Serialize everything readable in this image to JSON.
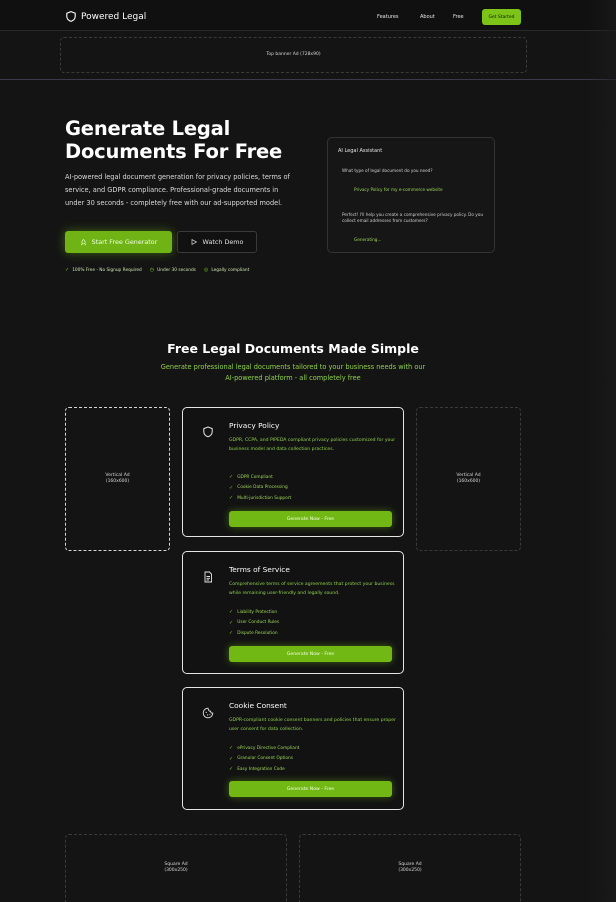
{
  "header": {
    "brand": "Powered Legal",
    "nav": [
      {
        "label": "Features"
      },
      {
        "label": "About"
      },
      {
        "label": "Free"
      }
    ],
    "cta": "Get Started"
  },
  "ads": {
    "top": "Top banner Ad (728x90)",
    "left": [
      "Vertical Ad",
      "(160x600)"
    ],
    "right": [
      "Vertical Ad",
      "(160x600)"
    ],
    "bottom_left": [
      "Square Ad",
      "(300x250)"
    ],
    "bottom_right": [
      "Square Ad",
      "(300x250)"
    ]
  },
  "hero": {
    "title_line1": "Generate Legal",
    "title_line2": "Documents For Free",
    "description": "AI-powered legal document generation for privacy policies, terms of service, and GDPR compliance. Professional-grade documents in under 30 seconds - completely free with our ad-supported model.",
    "primary_button": "Start Free Generator",
    "secondary_button": "Watch Demo",
    "trust": [
      "100% Free - No Signup Required",
      "Under 30 seconds",
      "Legally compliant"
    ]
  },
  "assistant": {
    "title": "AI Legal Assistant",
    "question1": "What type of legal document do you need?",
    "answer1": "Privacy Policy for my e-commerce website",
    "question2": "Perfect! I'll help you create a comprehensive privacy policy. Do you collect email addresses from customers?",
    "answer2": "Generating..."
  },
  "section": {
    "title": "Free Legal Documents Made Simple",
    "subtitle_line1": "Generate professional legal documents tailored to your business needs with our",
    "subtitle_line2": "AI-powered platform - all completely free"
  },
  "cards": [
    {
      "icon": "shield-icon",
      "title": "Privacy Policy",
      "description": "GDPR, CCPA, and PIPEDA compliant privacy policies customized for your business model and data collection practices.",
      "features": [
        "GDPR Compliant",
        "Cookie Data Processing",
        "Multi-jurisdiction Support"
      ],
      "button": "Generate Now - Free"
    },
    {
      "icon": "document-icon",
      "title": "Terms of Service",
      "description": "Comprehensive terms of service agreements that protect your business while remaining user-friendly and legally sound.",
      "features": [
        "Liability Protection",
        "User Conduct Rules",
        "Dispute Resolution"
      ],
      "button": "Generate Now - Free"
    },
    {
      "icon": "cookie-icon",
      "title": "Cookie Consent",
      "description": "GDPR-compliant cookie consent banners and policies that ensure proper user consent for data collection.",
      "features": [
        "ePrivacy Directive Compliant",
        "Granular Consent Options",
        "Easy Integration Code"
      ],
      "button": "Generate Now - Free"
    }
  ],
  "colors": {
    "accent": "#7cc418",
    "background": "#141414",
    "accent_text": "#8fd24a"
  }
}
